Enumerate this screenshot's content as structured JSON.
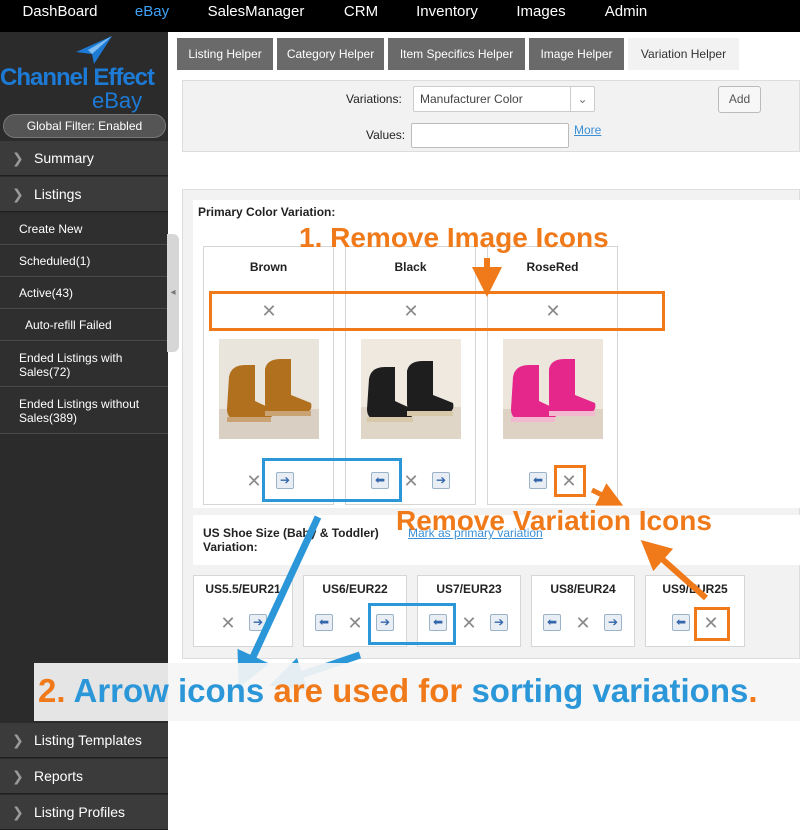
{
  "topnav": [
    "DashBoard",
    "eBay",
    "SalesManager",
    "CRM",
    "Inventory",
    "Images",
    "Admin"
  ],
  "brand": {
    "line1": "Channel Effect",
    "line2": "eBay"
  },
  "sidebar": {
    "global_filter": "Global Filter: Enabled",
    "sections_top": [
      "Summary",
      "Listings"
    ],
    "items": [
      "Create New",
      "Scheduled(1)",
      "Active(43)",
      "Auto-refill Failed",
      "Ended Listings with Sales(72)",
      "Ended Listings without Sales(389)"
    ],
    "sections_bottom": [
      "Listing Templates",
      "Reports",
      "Listing Profiles"
    ]
  },
  "tabs": [
    "Listing Helper",
    "Category Helper",
    "Item Specifics Helper",
    "Image Helper",
    "Variation Helper"
  ],
  "form": {
    "variations_label": "Variations:",
    "variations_value": "Manufacturer Color",
    "values_label": "Values:",
    "values_placeholder": "",
    "more_link": "More",
    "add_button": "Add"
  },
  "primary": {
    "title": "Primary Color Variation:",
    "colors": [
      "Brown",
      "Black",
      "RoseRed"
    ],
    "photo_colors": [
      "#b0701e",
      "#1e1e1e",
      "#e5268a"
    ]
  },
  "secondary": {
    "title": "US Shoe Size (Baby & Toddler) Variation:",
    "link": "Mark as primary variation",
    "sizes": [
      "US5.5/EUR21",
      "US6/EUR22",
      "US7/EUR23",
      "US8/EUR24",
      "US9/EUR25"
    ]
  },
  "annotations": {
    "remove_image": "1. Remove Image Icons",
    "remove_variation": "Remove Variation Icons",
    "caption_num": "2.",
    "caption_arrow": "Arrow",
    "caption_icons": "icons",
    "caption_are": "are used for",
    "caption_sorting": "sorting variations",
    "caption_dot": ".",
    "orange": "#f07a1a",
    "blue": "#2c97d8"
  }
}
